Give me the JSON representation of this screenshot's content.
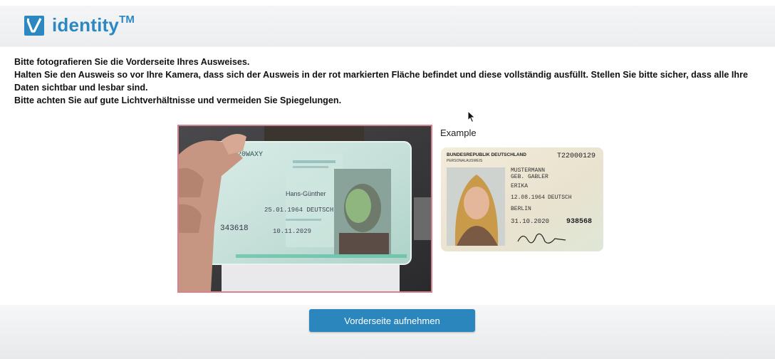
{
  "header": {
    "logo_text": "identity",
    "logo_trademark": "TM",
    "logo_icon": "identity-v-logo-icon",
    "brand_color": "#2b88c1"
  },
  "instructions": {
    "line1": "Bitte fotografieren Sie die Vorderseite Ihres Ausweises.",
    "line2": "Halten Sie den Ausweis so vor Ihre Kamera, dass sich der Ausweis in der rot markierten Fläche befindet und diese vollständig ausfüllt. Stellen Sie bitte sicher, dass alle Ihre Daten sichtbar und lesbar sind.",
    "line3": "Bitte achten Sie auf gute Lichtverhältnisse und vermeiden Sie Spiegelungen."
  },
  "camera": {
    "frame_color": "#d9818f",
    "card_texts": {
      "top_code": "T020WAXY",
      "name1": "Hans-Günther",
      "birthdate": "25.01.1964 DEUTSCH",
      "side_num": "343618",
      "valid": "10.11.2029"
    }
  },
  "example": {
    "label": "Example",
    "card": {
      "country": "BUNDESREPUBLIK DEUTSCHLAND",
      "doc_number": "T22000129",
      "doc_type": "PERSONALAUSWEIS",
      "surname": "MUSTERMANN",
      "birth_name": "GEB. GABLER",
      "given_name": "ERIKA",
      "birth_date": "12.08.1964",
      "nationality": "DEUTSCH",
      "birth_place": "BERLIN",
      "expiry": "31.10.2020",
      "can": "938568"
    }
  },
  "actions": {
    "capture_label": "Vorderseite aufnehmen",
    "button_color": "#2a86bd"
  }
}
